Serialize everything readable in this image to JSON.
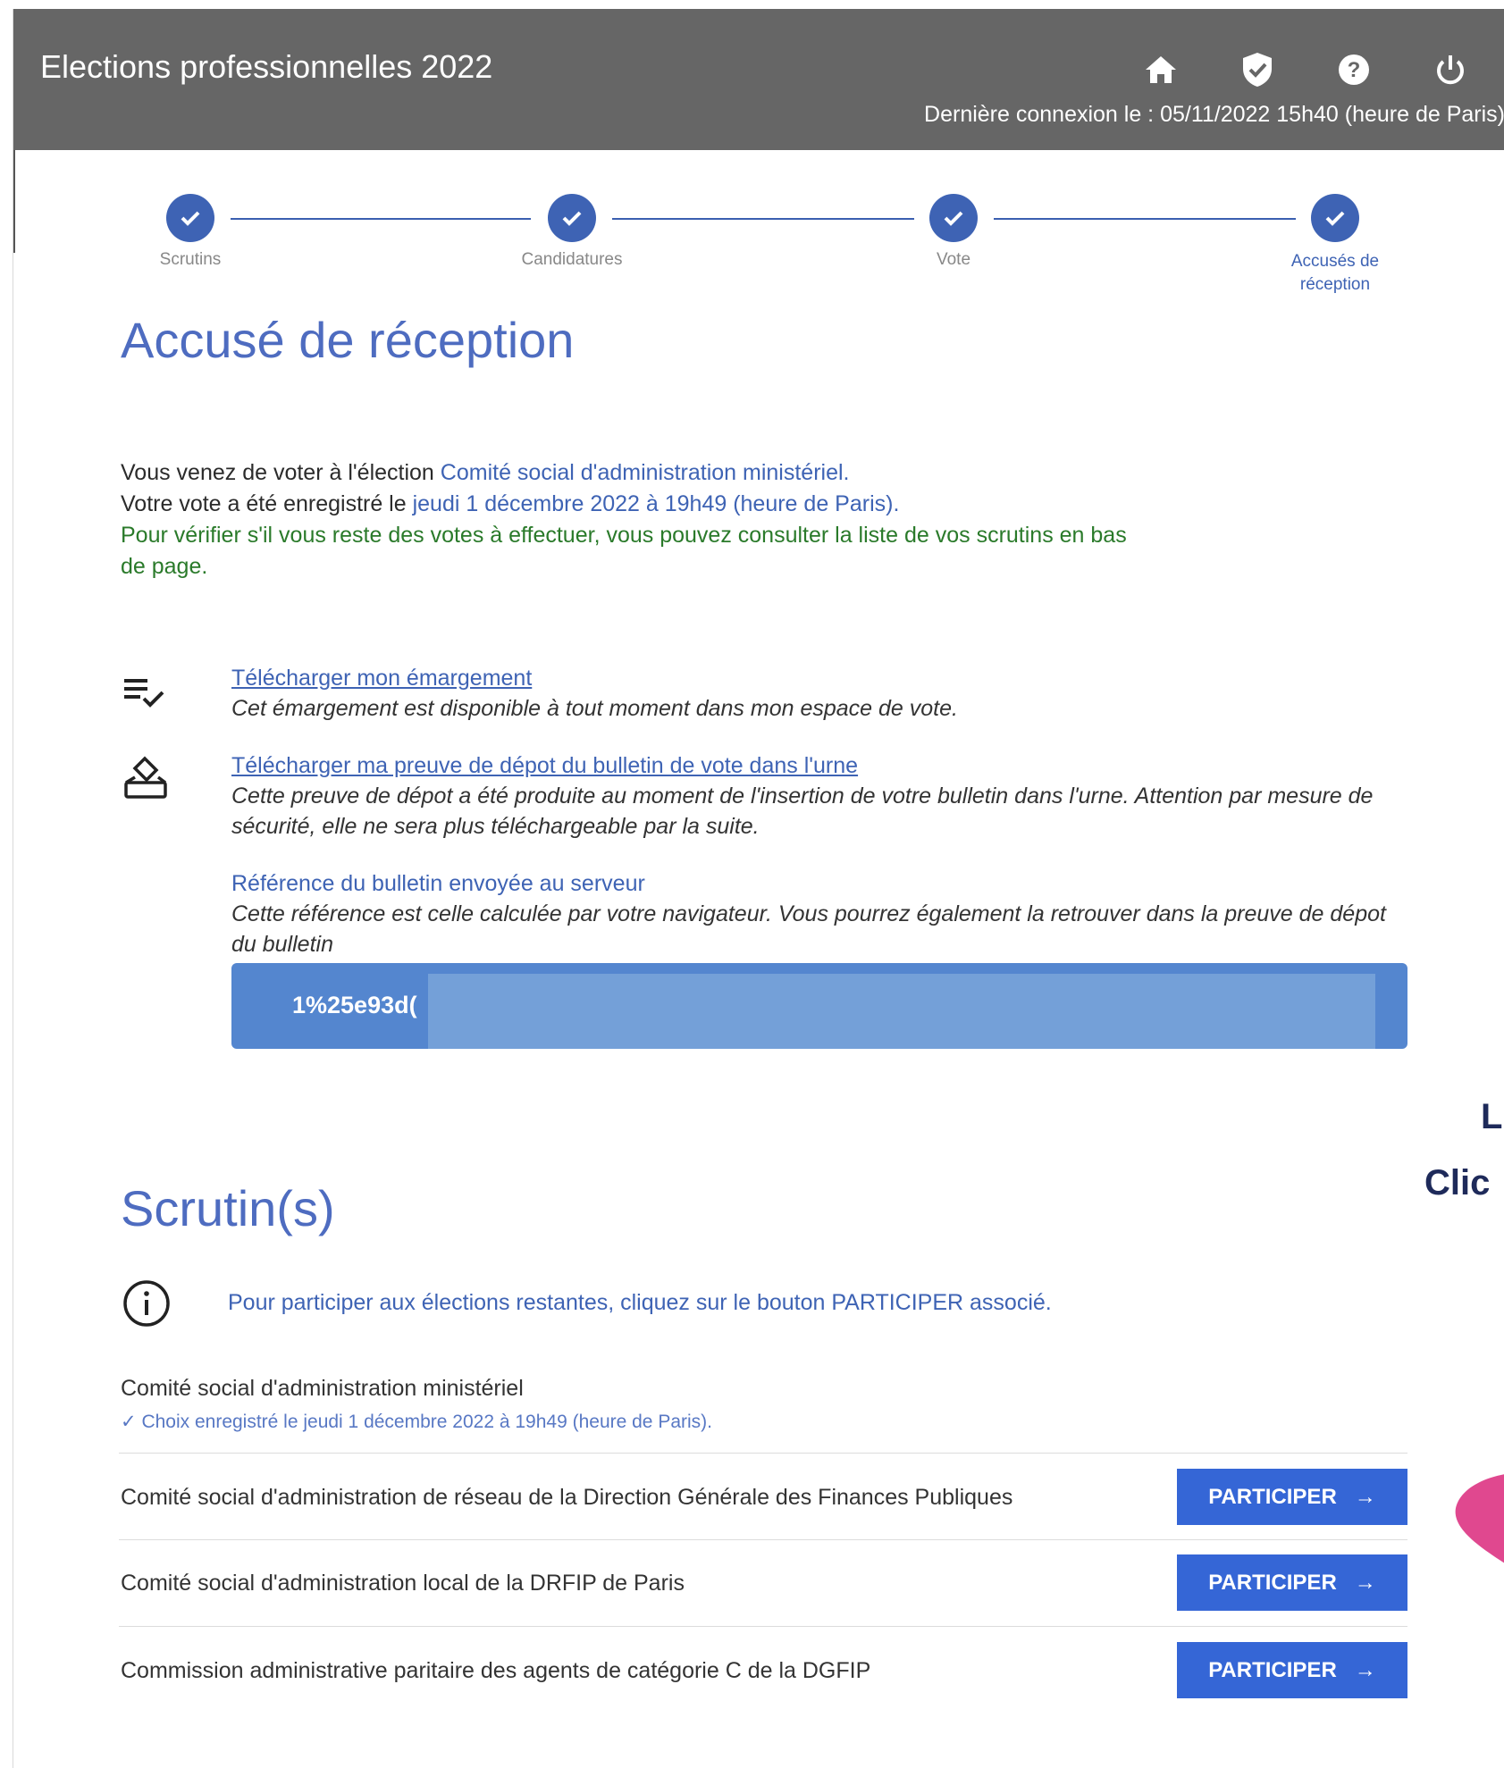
{
  "header": {
    "title": "Elections professionnelles 2022",
    "last_login": "Dernière connexion le : 05/11/2022 15h40 (heure de Paris)",
    "icons": [
      "home-icon",
      "shield-check-icon",
      "help-icon",
      "power-icon"
    ]
  },
  "stepper": {
    "steps": [
      {
        "label": "Scrutins"
      },
      {
        "label": "Candidatures"
      },
      {
        "label": "Vote"
      },
      {
        "label_line1": "Accusés de",
        "label_line2": "réception"
      }
    ]
  },
  "page_title": "Accusé de réception",
  "intro": {
    "line1_prefix": "Vous venez de voter à l'élection ",
    "line1_election": "Comité social d'administration ministériel.",
    "line2_prefix": "Votre vote a été enregistré le ",
    "line2_date": "jeudi 1 décembre 2022 à 19h49 (heure de Paris).",
    "line3": "Pour vérifier s'il vous reste des votes à effectuer, vous pouvez consulter la liste de vos scrutins en bas de page."
  },
  "downloads": {
    "emargement_link": "Télécharger mon émargement",
    "emargement_desc": "Cet émargement est disponible à tout moment dans mon espace de vote.",
    "preuve_link": "Télécharger ma preuve de dépot du bulletin de vote dans l'urne",
    "preuve_desc": "Cette preuve de dépot a été produite au moment de l'insertion de votre bulletin dans l'urne. Attention par mesure de sécurité, elle ne sera plus téléchargeable par la suite.",
    "ref_title": "Référence du bulletin envoyée au serveur",
    "ref_desc": "Cette référence est celle calculée par votre navigateur. Vous pourrez également la retrouver dans la preuve de dépot du bulletin",
    "ref_value": "1%25e93d("
  },
  "scrutins": {
    "title": "Scrutin(s)",
    "info": "Pour participer aux élections restantes, cliquez sur le bouton PARTICIPER associé.",
    "done": {
      "name": "Comité social d'administration ministériel",
      "status": "Choix enregistré le jeudi 1 décembre 2022 à 19h49 (heure de Paris)."
    },
    "items": [
      {
        "name": "Comité social d'administration de réseau de la Direction Générale des Finances Publiques",
        "button": "PARTICIPER"
      },
      {
        "name": "Comité social d'administration local de la DRFIP de Paris",
        "button": "PARTICIPER"
      },
      {
        "name": "Commission administrative paritaire des agents de catégorie C de la DGFIP",
        "button": "PARTICIPER"
      }
    ]
  },
  "side_text": {
    "line1": "L",
    "line2": "Clic"
  },
  "colors": {
    "header_bg": "#666666",
    "accent": "#3e63b4",
    "button": "#3566d6",
    "green": "#2a7a2a",
    "ref_bar": "#5486cf",
    "pink_shape": "#e0488f"
  }
}
